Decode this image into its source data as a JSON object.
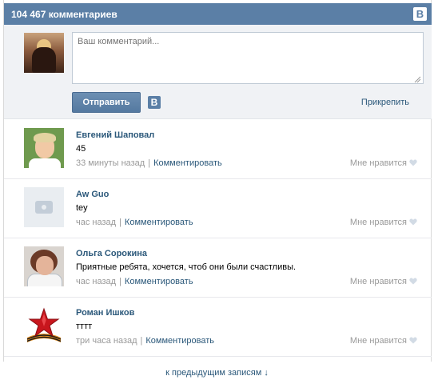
{
  "header": {
    "title": "104 467 комментариев",
    "logo": "В"
  },
  "compose": {
    "placeholder": "Ваш комментарий...",
    "send_label": "Отправить",
    "vk_badge": "В",
    "attach_label": "Прикрепить"
  },
  "comments": [
    {
      "author": "Евгений Шаповал",
      "text": "45",
      "time": "33 минуты назад",
      "reply": "Комментировать",
      "like": "Мне нравится"
    },
    {
      "author": "Aw Guo",
      "text": "tey",
      "time": "час назад",
      "reply": "Комментировать",
      "like": "Мне нравится"
    },
    {
      "author": "Ольга Сорокина",
      "text": "Приятные ребята, хочется, чтоб они были счастливы.",
      "time": "час назад",
      "reply": "Комментировать",
      "like": "Мне нравится"
    },
    {
      "author": "Роман Ишков",
      "text": "тттт",
      "time": "три часа назад",
      "reply": "Комментировать",
      "like": "Мне нравится"
    }
  ],
  "footer": {
    "prev_link": "к предыдущим записям ↓"
  },
  "colors": {
    "header_bg": "#5b7fa6",
    "link": "#2b587a",
    "muted": "#999999",
    "compose_bg": "#f0f2f5"
  }
}
